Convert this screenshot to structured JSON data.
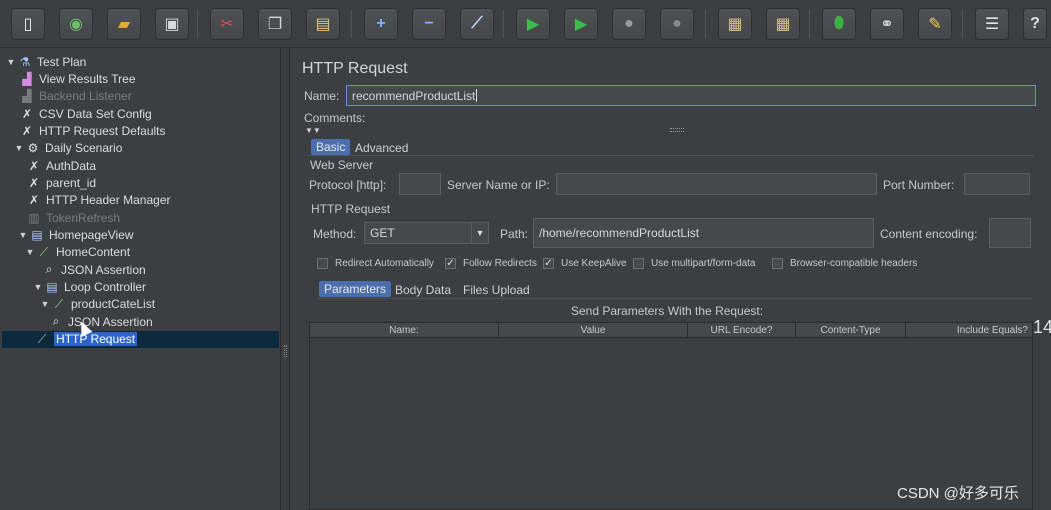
{
  "toolbar": {
    "buttons": [
      {
        "name": "new-icon",
        "glyph": "▯",
        "color": "#f2f2f2"
      },
      {
        "name": "templates-icon",
        "glyph": "◉",
        "color": "#6cc06c"
      },
      {
        "name": "open-icon",
        "glyph": "▰",
        "color": "#e5a93a"
      },
      {
        "name": "save-icon",
        "glyph": "▣",
        "color": "#d8d8d8"
      },
      {
        "name": "cut-icon",
        "glyph": "✂",
        "color": "#e05050"
      },
      {
        "name": "copy-icon",
        "glyph": "❐",
        "color": "#d8d8d8"
      },
      {
        "name": "paste-icon",
        "glyph": "▤",
        "color": "#e8c878"
      },
      {
        "name": "expand-icon",
        "glyph": "+",
        "color": "#7fb6ff"
      },
      {
        "name": "collapse-icon",
        "glyph": "−",
        "color": "#7fb6ff"
      },
      {
        "name": "toggle-icon",
        "glyph": "⟋",
        "color": "#bcd6ff"
      },
      {
        "name": "start-icon",
        "glyph": "▶",
        "color": "#3cc04a"
      },
      {
        "name": "start-no-pauses-icon",
        "glyph": "▶",
        "color": "#3cc04a"
      },
      {
        "name": "stop-icon",
        "glyph": "●",
        "color": "#9a9a9a"
      },
      {
        "name": "shutdown-icon",
        "glyph": "●",
        "color": "#8a8a8a"
      },
      {
        "name": "clear-icon",
        "glyph": "▦",
        "color": "#d9c08a"
      },
      {
        "name": "clear-all-icon",
        "glyph": "▦",
        "color": "#d9c08a"
      },
      {
        "name": "search-icon",
        "glyph": "⬮",
        "color": "#3cb043"
      },
      {
        "name": "binoculars-icon",
        "glyph": "⚭",
        "color": "#e0e0e0"
      },
      {
        "name": "reset-search-icon",
        "glyph": "✎",
        "color": "#f0d040"
      },
      {
        "name": "function-helper-icon",
        "glyph": "☰",
        "color": "#e0e0e0"
      },
      {
        "name": "help-icon",
        "glyph": "?",
        "color": "#e0e0e0"
      }
    ]
  },
  "tree": {
    "nodes": [
      {
        "label": "Test Plan",
        "toggle": "▼",
        "icon": "flask-icon",
        "glyph": "⚗",
        "color": "#a9c7ff",
        "disabled": false
      },
      {
        "label": "View Results Tree",
        "toggle": "",
        "icon": "graph-icon",
        "glyph": "▟",
        "color": "#d58ce0",
        "disabled": false
      },
      {
        "label": "Backend Listener",
        "toggle": "",
        "icon": "graph-icon",
        "glyph": "▟",
        "color": "#7a7a7a",
        "disabled": true
      },
      {
        "label": "CSV Data Set Config",
        "toggle": "",
        "icon": "wrench-icon",
        "glyph": "✗",
        "color": "#e0e0e0",
        "disabled": false
      },
      {
        "label": "HTTP Request Defaults",
        "toggle": "",
        "icon": "wrench-icon",
        "glyph": "✗",
        "color": "#e0e0e0",
        "disabled": false
      },
      {
        "label": "Daily Scenario",
        "toggle": "▼",
        "icon": "gear-icon",
        "glyph": "⚙",
        "color": "#e0e0e0",
        "disabled": false
      },
      {
        "label": "AuthData",
        "toggle": "",
        "icon": "wrench-icon",
        "glyph": "✗",
        "color": "#e0e0e0",
        "disabled": false
      },
      {
        "label": "parent_id",
        "toggle": "",
        "icon": "wrench-icon",
        "glyph": "✗",
        "color": "#e0e0e0",
        "disabled": false
      },
      {
        "label": "HTTP Header Manager",
        "toggle": "",
        "icon": "wrench-icon",
        "glyph": "✗",
        "color": "#e0e0e0",
        "disabled": false
      },
      {
        "label": "TokenRefresh",
        "toggle": "",
        "icon": "sampler-icon",
        "glyph": "▥",
        "color": "#7a7a7a",
        "disabled": true
      },
      {
        "label": "HomepageView",
        "toggle": "▼",
        "icon": "controller-icon",
        "glyph": "▤",
        "color": "#a9c7ff",
        "disabled": false
      },
      {
        "label": "HomeContent",
        "toggle": "▼",
        "icon": "pipette-icon",
        "glyph": "⟋",
        "color": "#9ad08a",
        "disabled": false
      },
      {
        "label": "JSON Assertion",
        "toggle": "",
        "icon": "magnifier-icon",
        "glyph": "⌕",
        "color": "#e0e0e0",
        "disabled": false
      },
      {
        "label": "Loop Controller",
        "toggle": "▼",
        "icon": "controller-icon",
        "glyph": "▤",
        "color": "#a9c7ff",
        "disabled": false
      },
      {
        "label": "productCateList",
        "toggle": "▼",
        "icon": "pipette-icon",
        "glyph": "⟋",
        "color": "#9ad08a",
        "disabled": false
      },
      {
        "label": "JSON Assertion",
        "toggle": "",
        "icon": "magnifier-icon",
        "glyph": "⌕",
        "color": "#e0e0e0",
        "disabled": false
      },
      {
        "label": "HTTP Request",
        "toggle": "",
        "icon": "pipette-icon",
        "glyph": "⟋",
        "color": "#9ad08a",
        "disabled": false,
        "selected": true
      }
    ]
  },
  "panel": {
    "title": "HTTP Request",
    "name_label": "Name:",
    "name_value": "recommendProductList",
    "comments_label": "Comments:",
    "tabs": [
      {
        "label": "Basic",
        "active": true
      },
      {
        "label": "Advanced",
        "active": false
      }
    ],
    "web_server": {
      "title": "Web Server",
      "protocol_label": "Protocol [http]:",
      "protocol_value": "",
      "server_label": "Server Name or IP:",
      "server_value": "",
      "port_label": "Port Number:",
      "port_value": ""
    },
    "http_request": {
      "title": "HTTP Request",
      "method_label": "Method:",
      "method_value": "GET",
      "path_label": "Path:",
      "path_value": "/home/recommendProductList",
      "encoding_label": "Content encoding:",
      "encoding_value": ""
    },
    "options": [
      {
        "label": "Redirect Automatically",
        "checked": false
      },
      {
        "label": "Follow Redirects",
        "checked": true
      },
      {
        "label": "Use KeepAlive",
        "checked": true
      },
      {
        "label": "Use multipart/form-data",
        "checked": false
      },
      {
        "label": "Browser-compatible headers",
        "checked": false
      }
    ],
    "subtabs": [
      {
        "label": "Parameters",
        "active": true
      },
      {
        "label": "Body Data",
        "active": false
      },
      {
        "label": "Files Upload",
        "active": false
      }
    ],
    "params_title": "Send Parameters With the Request:",
    "params_columns": [
      "Name:",
      "Value",
      "URL Encode?",
      "Content-Type",
      "Include Equals?"
    ]
  },
  "overflow_text": "14",
  "watermark": "CSDN @好多可乐"
}
